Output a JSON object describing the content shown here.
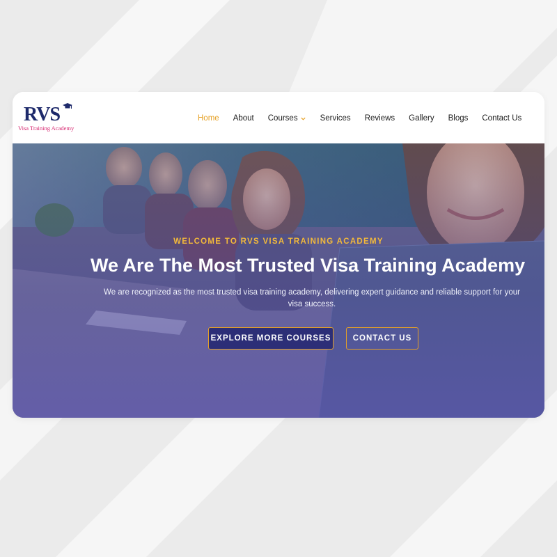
{
  "brand": {
    "logo_mark": "RVS",
    "tagline": "Visa Training Academy",
    "colors": {
      "navy": "#1e2a6b",
      "pink": "#d6246e",
      "accent": "#e6a126",
      "button_bg": "#2c2e77"
    }
  },
  "nav": {
    "items": [
      {
        "label": "Home",
        "active": true
      },
      {
        "label": "About"
      },
      {
        "label": "Courses",
        "has_dropdown": true
      },
      {
        "label": "Services"
      },
      {
        "label": "Reviews"
      },
      {
        "label": "Gallery"
      },
      {
        "label": "Blogs"
      },
      {
        "label": "Contact Us"
      }
    ]
  },
  "hero": {
    "eyebrow": "WELCOME TO RVS VISA TRAINING ACADEMY",
    "headline": "We Are The Most Trusted Visa Training Academy",
    "subtext": "We are recognized as the most trusted visa training academy, delivering expert guidance and reliable support for your visa success.",
    "primary_button": "EXPLORE MORE COURSES",
    "secondary_button": "CONTACT US"
  },
  "icons": [
    "graduation-cap-icon",
    "chevron-down-icon"
  ]
}
